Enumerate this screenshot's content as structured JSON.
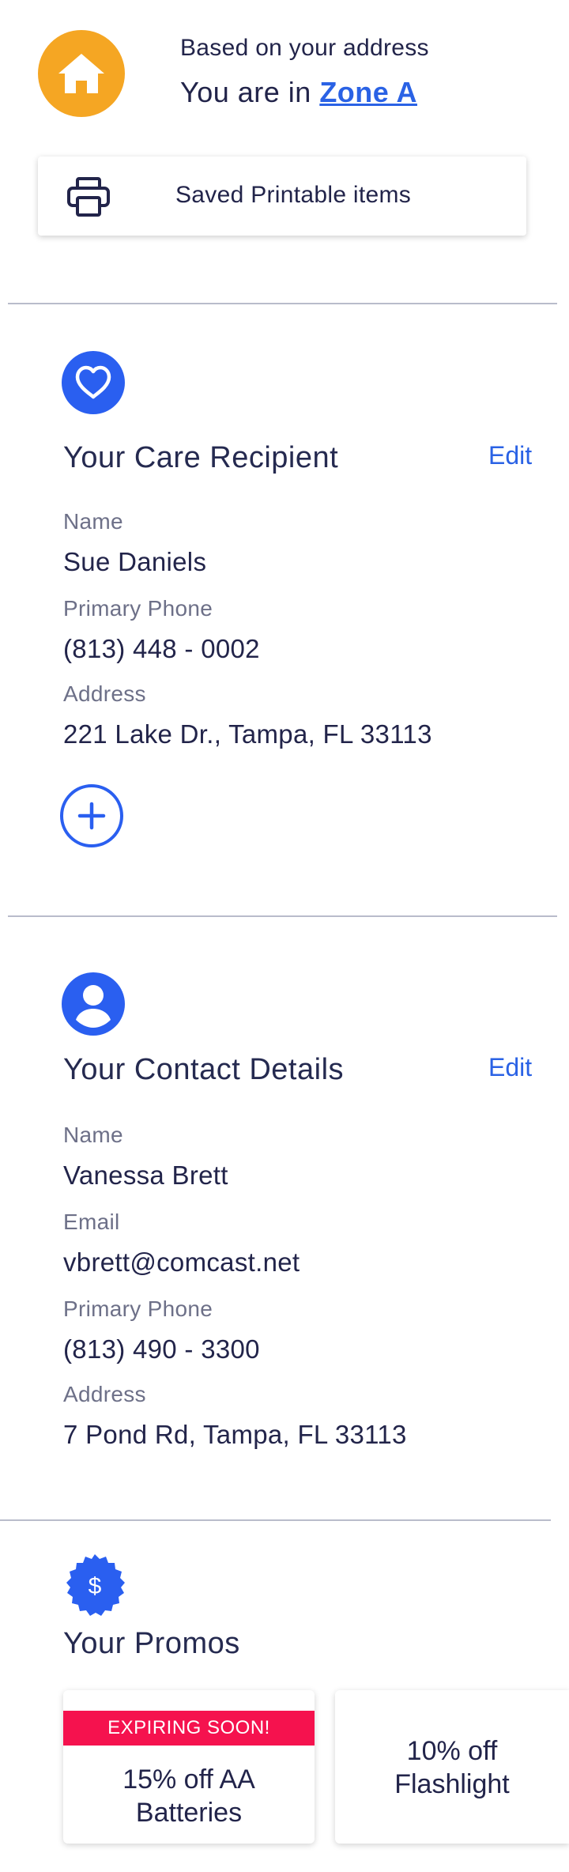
{
  "zone": {
    "icon": "home-icon",
    "subtitle": "Based on your address",
    "prefix": "You are in ",
    "zone_link": "Zone A"
  },
  "printables": {
    "icon": "printer-icon",
    "label": "Saved Printable items"
  },
  "care_recipient": {
    "icon": "heart-icon",
    "title": "Your Care Recipient",
    "edit_label": "Edit",
    "name_label": "Name",
    "name_value": "Sue Daniels",
    "phone_label": "Primary Phone",
    "phone_value": "(813) 448 - 0002",
    "address_label": "Address",
    "address_value": "221 Lake Dr., Tampa, FL 33113",
    "add_icon": "plus-icon"
  },
  "contact": {
    "icon": "user-icon",
    "title": "Your Contact Details",
    "edit_label": "Edit",
    "name_label": "Name",
    "name_value": "Vanessa Brett",
    "email_label": "Email",
    "email_value": "vbrett@comcast.net",
    "phone_label": "Primary Phone",
    "phone_value": "(813) 490 - 3300",
    "address_label": "Address",
    "address_value": "7 Pond Rd, Tampa, FL 33113"
  },
  "promos": {
    "icon": "dollar-badge-icon",
    "title": "Your Promos",
    "items": [
      {
        "badge": "EXPIRING SOON!",
        "line1": "15% off AA",
        "line2": "Batteries"
      },
      {
        "line1": "10% off",
        "line2": "Flashlight"
      }
    ]
  },
  "colors": {
    "accent": "#2a5ff0",
    "home_badge": "#f5a623",
    "expiring_badge": "#f5124e",
    "divider": "#b9bccb"
  }
}
